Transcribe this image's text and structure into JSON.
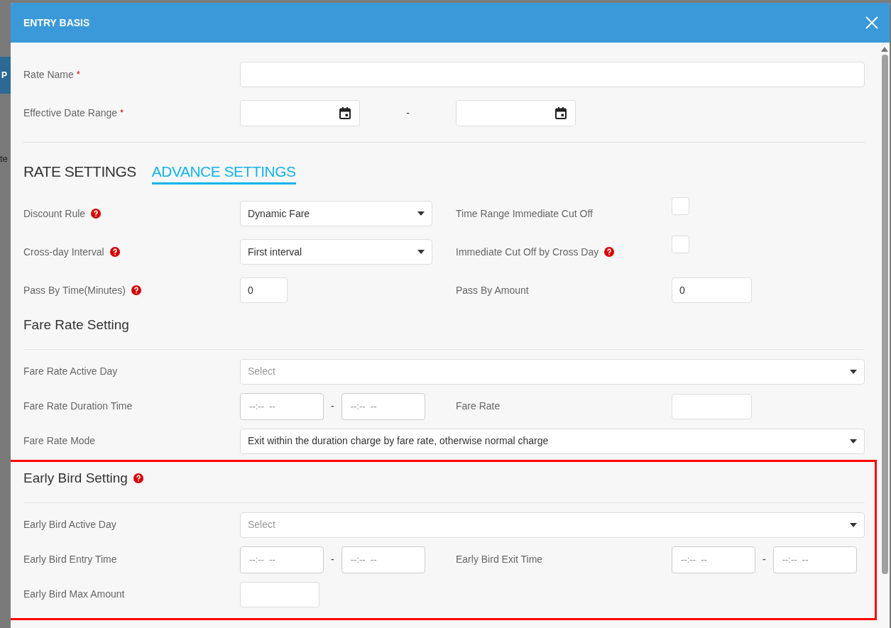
{
  "backdrop": {
    "fragments": [
      "P",
      "te"
    ]
  },
  "dialog": {
    "title": "ENTRY BASIS"
  },
  "basic_fields": [
    {
      "kind": "text",
      "label": "Rate Name",
      "required_mark": "*"
    },
    {
      "kind": "date_range",
      "label": "Effective Date Range",
      "required_mark": "*",
      "separator": "-"
    }
  ],
  "tabs": [
    {
      "label": "RATE SETTINGS",
      "selected": false
    },
    {
      "label": "ADVANCE SETTINGS",
      "selected": true
    }
  ],
  "advance_rows": [
    {
      "left": {
        "label": "Discount Rule",
        "help": true,
        "kind": "select",
        "value": "Dynamic Fare"
      },
      "right": {
        "label": "Time Range Immediate Cut Off",
        "help": false,
        "kind": "checkbox",
        "checked": false
      }
    },
    {
      "left": {
        "label": "Cross-day Interval",
        "help": true,
        "kind": "select",
        "value": "First interval"
      },
      "right": {
        "label": "Immediate Cut Off by Cross Day",
        "help": true,
        "kind": "checkbox",
        "checked": false
      }
    },
    {
      "left": {
        "label": "Pass By Time(Minutes)",
        "help": true,
        "kind": "number",
        "value": "0"
      },
      "right": {
        "label": "Pass By Amount",
        "help": false,
        "kind": "number",
        "value": "0"
      }
    }
  ],
  "sections": [
    {
      "title": "Fare Rate Setting",
      "help": false,
      "highlighted": false,
      "rows": [
        {
          "kind": "wide_select",
          "label": "Fare Rate Active Day",
          "placeholder": "Select"
        },
        {
          "kind": "time_range",
          "label": "Fare Rate Duration Time",
          "times": [
            "--:--  --",
            "--:--  --"
          ],
          "separator": "-",
          "right": {
            "label": "Fare Rate",
            "kind": "number"
          }
        },
        {
          "kind": "wide_select",
          "label": "Fare Rate Mode",
          "value": "Exit within the duration charge by fare rate, otherwise normal charge"
        }
      ]
    },
    {
      "title": "Early Bird Setting",
      "help": true,
      "highlighted": true,
      "rows": [
        {
          "kind": "wide_select",
          "label": "Early Bird Active Day",
          "placeholder": "Select"
        },
        {
          "kind": "time_range",
          "label": "Early Bird Entry Time",
          "times": [
            "--:--  --",
            "--:--  --"
          ],
          "separator": "-",
          "right": {
            "label": "Early Bird Exit Time",
            "kind": "time_range",
            "times": [
              "--:--  --",
              "--:--  --"
            ],
            "separator": "-"
          }
        },
        {
          "kind": "number",
          "label": "Early Bird Max Amount"
        }
      ]
    }
  ]
}
